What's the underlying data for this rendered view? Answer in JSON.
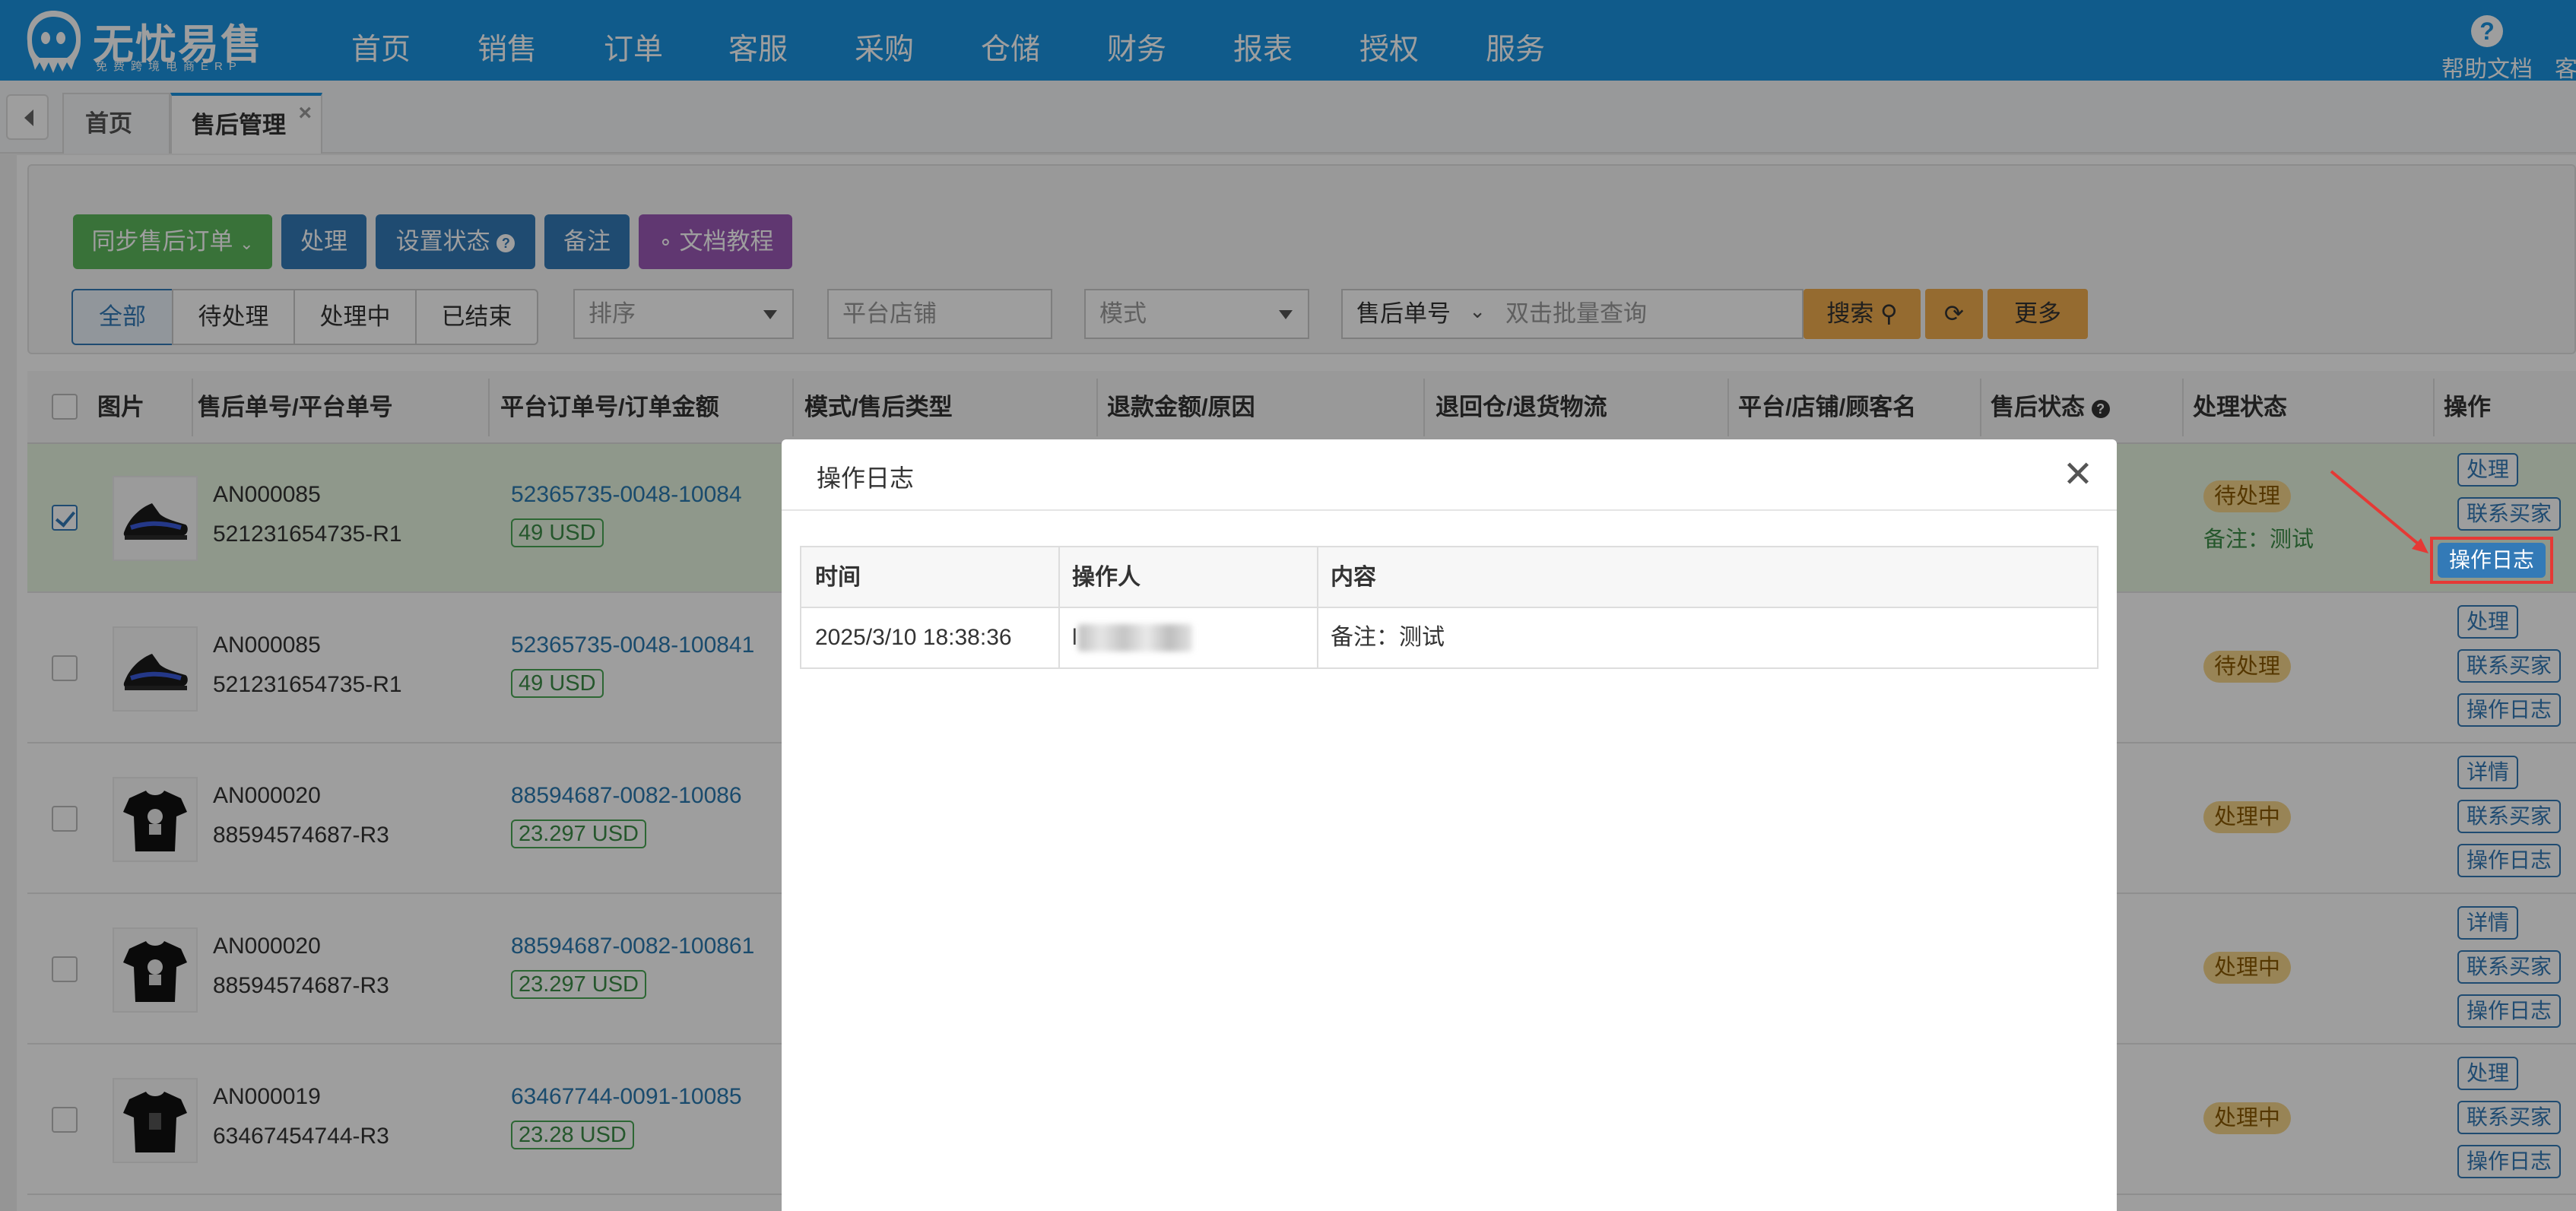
{
  "app": {
    "logo_title": "无忧易售",
    "logo_subtitle": "免费跨境电商ERP",
    "nav": [
      "首页",
      "销售",
      "订单",
      "客服",
      "采购",
      "仓储",
      "财务",
      "报表",
      "授权",
      "服务"
    ],
    "help_label": "帮助文档",
    "service_label": "客"
  },
  "tabs": {
    "items": [
      {
        "label": "首页"
      },
      {
        "label": "售后管理"
      }
    ],
    "close_glyph": "×"
  },
  "toolbar": {
    "sync_label": "同步售后订单",
    "handle_label": "处理",
    "set_status_label": "设置状态",
    "note_label": "备注",
    "doc_label": "文档教程",
    "filters": [
      "全部",
      "待处理",
      "处理中",
      "已结束"
    ],
    "sort_placeholder": "排序",
    "shop_placeholder": "平台店铺",
    "mode_placeholder": "模式",
    "search_type": "售后单号",
    "search_placeholder": "双击批量查询",
    "search_label": "搜索",
    "more_label": "更多"
  },
  "table": {
    "headers": [
      "图片",
      "售后单号/平台单号",
      "平台订单号/订单金额",
      "模式/售后类型",
      "退款金额/原因",
      "退回仓/退货物流",
      "平台/店铺/顾客名",
      "售后状态",
      "处理状态",
      "操作"
    ],
    "rows": [
      {
        "after_no": "AN000085",
        "platform_no": "521231654735-R1",
        "order_no": "52365735-0048-10084",
        "amount": "49 USD",
        "status": "待处理",
        "note": "备注：测试",
        "ops": [
          "处理",
          "联系买家",
          "操作日志"
        ],
        "thumb": "shoe",
        "checked": true
      },
      {
        "after_no": "AN000085",
        "platform_no": "521231654735-R1",
        "order_no": "52365735-0048-100841",
        "amount": "49 USD",
        "status": "待处理",
        "note": "",
        "ops": [
          "处理",
          "联系买家",
          "操作日志"
        ],
        "thumb": "shoe",
        "checked": false
      },
      {
        "after_no": "AN000020",
        "platform_no": "88594574687-R3",
        "order_no": "88594687-0082-10086",
        "amount": "23.297 USD",
        "status": "处理中",
        "note": "",
        "ops": [
          "详情",
          "联系买家",
          "操作日志"
        ],
        "thumb": "tshirt",
        "checked": false
      },
      {
        "after_no": "AN000020",
        "platform_no": "88594574687-R3",
        "order_no": "88594687-0082-100861",
        "amount": "23.297 USD",
        "status": "处理中",
        "note": "",
        "ops": [
          "详情",
          "联系买家",
          "操作日志"
        ],
        "thumb": "tshirt",
        "checked": false
      },
      {
        "after_no": "AN000019",
        "platform_no": "63467454744-R3",
        "order_no": "63467744-0091-10085",
        "amount": "23.28 USD",
        "status": "处理中",
        "note": "",
        "ops": [
          "处理",
          "联系买家",
          "操作日志"
        ],
        "thumb": "tshirt",
        "checked": false
      }
    ]
  },
  "modal": {
    "title": "操作日志",
    "columns": [
      "时间",
      "操作人",
      "内容"
    ],
    "entries": [
      {
        "time": "2025/3/10 18:38:36",
        "operator": "l",
        "content": "备注：测试"
      }
    ]
  },
  "colors": {
    "brand": "#1a93e0",
    "primary": "#337ab7",
    "success": "#5cb85c",
    "warning": "#f0ad4e",
    "highlight": "#e53935"
  }
}
